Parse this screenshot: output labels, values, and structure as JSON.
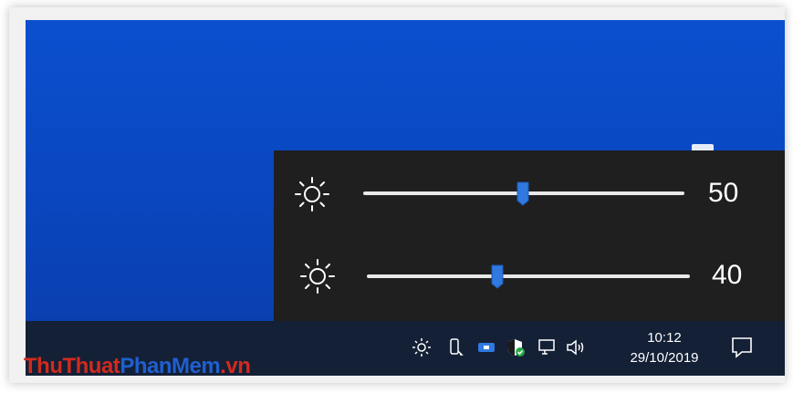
{
  "brightness_flyout": {
    "sliders": [
      {
        "value": 50,
        "label": "50",
        "icon": "sun-icon"
      },
      {
        "value": 40,
        "label": "40",
        "icon": "sun-icon"
      }
    ],
    "accent": "#2f79e0"
  },
  "taskbar": {
    "tray_icons": [
      "brightness-sun-icon",
      "usb-drive-icon",
      "app-tray-icon",
      "security-shield-icon",
      "network-icon",
      "volume-icon"
    ],
    "time": "10:12",
    "date": "29/10/2019",
    "notification_icon": "action-center-icon"
  },
  "watermark": {
    "part1": "ThuThuat",
    "part2": "PhanMem",
    "part3": ".vn"
  }
}
